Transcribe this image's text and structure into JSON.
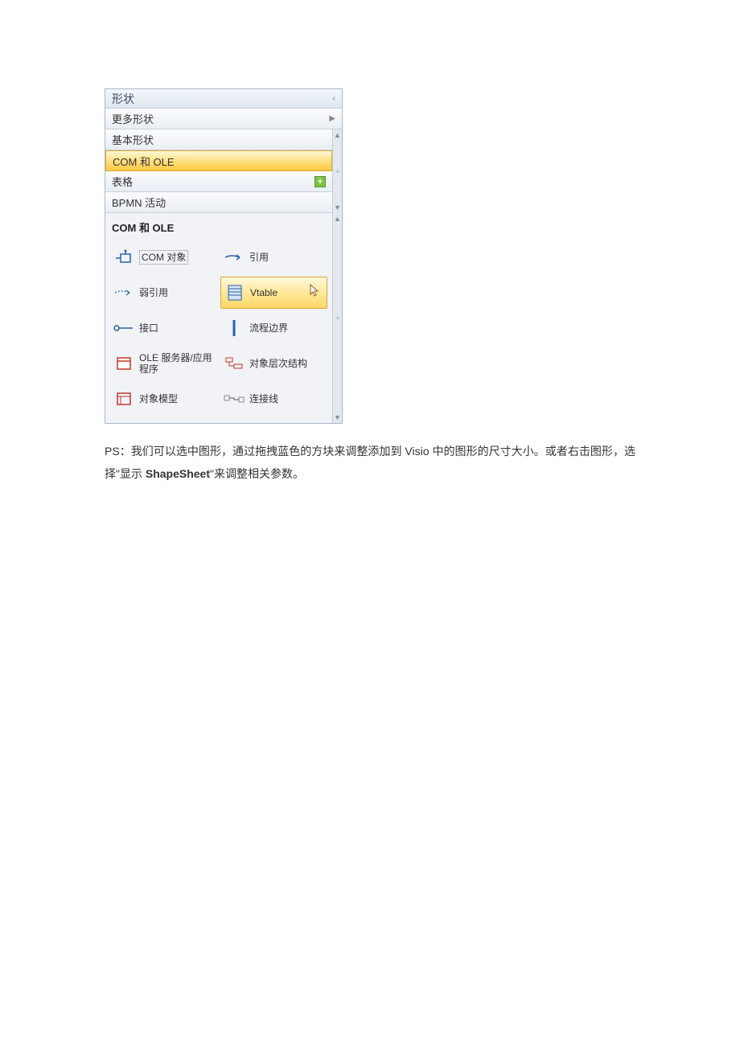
{
  "panel": {
    "title": "形状",
    "more_shapes": "更多形状",
    "categories": [
      {
        "label": "基本形状"
      },
      {
        "label": "COM 和 OLE",
        "selected": true
      },
      {
        "label": "表格",
        "has_plus": true
      },
      {
        "label": "BPMN 活动"
      }
    ],
    "stencil_title": "COM 和 OLE",
    "shapes": [
      {
        "name": "com-object",
        "label": "COM 对象",
        "icon": "com-object",
        "dotted": true
      },
      {
        "name": "reference",
        "label": "引用",
        "icon": "arrow-ref"
      },
      {
        "name": "weak-reference",
        "label": "弱引用",
        "icon": "arrow-weak"
      },
      {
        "name": "vtable",
        "label": "Vtable",
        "icon": "vtable",
        "hovered": true
      },
      {
        "name": "interface",
        "label": "接口",
        "icon": "lollipop"
      },
      {
        "name": "process-boundary",
        "label": "流程边界",
        "icon": "vbar"
      },
      {
        "name": "ole-server",
        "label": "OLE 服务器/应用程序",
        "icon": "ole-box",
        "two_line": true
      },
      {
        "name": "object-hierarchy",
        "label": "对象层次结构",
        "icon": "hierarchy"
      },
      {
        "name": "object-model",
        "label": "对象模型",
        "icon": "object-model"
      },
      {
        "name": "connector",
        "label": "连接线",
        "icon": "connector"
      }
    ]
  },
  "note": {
    "prefix": "PS：我们可以选中图形，通过拖拽蓝色的方块来调整添加到 Visio 中的图形的尺寸大小。或者右击图形，选择\"显示 ",
    "bold": "ShapeSheet",
    "suffix": "\"来调整相关参数。"
  }
}
